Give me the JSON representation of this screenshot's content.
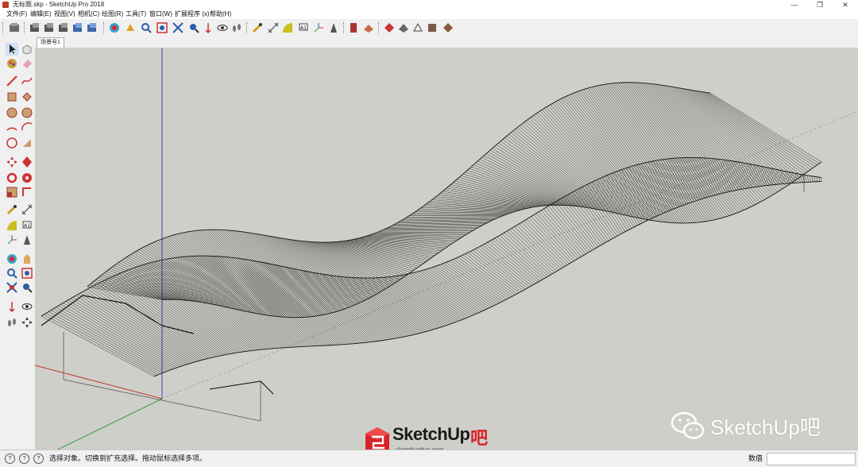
{
  "window": {
    "title": "无标题.skp - SketchUp Pro 2018",
    "minimize": "—",
    "maximize": "❐",
    "close": "✕"
  },
  "menu": [
    {
      "label": "文件(F)"
    },
    {
      "label": "编辑(E)"
    },
    {
      "label": "视图(V)"
    },
    {
      "label": "相机(C)"
    },
    {
      "label": "绘图(R)"
    },
    {
      "label": "工具(T)"
    },
    {
      "label": "窗口(W)"
    },
    {
      "label": "扩展程序 (x)"
    },
    {
      "label": "帮助(H)"
    }
  ],
  "scene_tab": "场景号1",
  "status": {
    "help1": "?",
    "help2": "?",
    "message": "选择对象。切换到扩充选择。拖动鼠标选择多项。",
    "measurements_label": "数值",
    "measurements_value": ""
  },
  "branding": {
    "logo_text": "SketchUp",
    "logo_suffix": "吧",
    "logo_url": "sketchupbar.com",
    "watermark": "SketchUp吧"
  },
  "colors": {
    "viewport_bg": "#cfcfca",
    "axis_red": "#c0392b",
    "axis_green": "#2e9d3a",
    "axis_blue": "#3a4fb0",
    "brand_red": "#d8232a"
  },
  "icons": {
    "toolbar": [
      "select-icon",
      "component-icon",
      "paint-icon",
      "eraser-icon",
      "tape-icon",
      "orbit-icon",
      "pan-icon",
      "zoom-icon",
      "zoom-window-icon",
      "zoom-extents-icon",
      "previous-icon",
      "position-camera-icon",
      "walk-icon",
      "look-around-icon",
      "dimension-icon",
      "protractor-icon",
      "text-icon",
      "axes-icon",
      "3d-text-icon",
      "section-plane-icon",
      "sandbox-icon",
      "warehouse-icon",
      "extension-icon",
      "layout-icon",
      "style-icon",
      "shadow-icon",
      "fog-icon"
    ],
    "left": [
      "select-icon",
      "component-icon",
      "paint-icon",
      "eraser-icon",
      "line-icon",
      "freehand-icon",
      "rectangle-icon",
      "rotated-rect-icon",
      "circle-icon",
      "polygon-icon",
      "arc-icon",
      "pie-icon",
      "push-pull-icon",
      "move-icon",
      "rotate-icon",
      "follow-me-icon",
      "scale-icon",
      "offset-icon",
      "tape-icon",
      "dimension-icon",
      "protractor-icon",
      "text-icon",
      "axes-icon",
      "3d-text-icon",
      "orbit-icon",
      "pan-icon",
      "zoom-icon",
      "zoom-window-icon",
      "zoom-extents-icon",
      "walk-icon",
      "look-around-icon",
      "position-camera-icon",
      "section-icon",
      "footprints-icon"
    ]
  }
}
